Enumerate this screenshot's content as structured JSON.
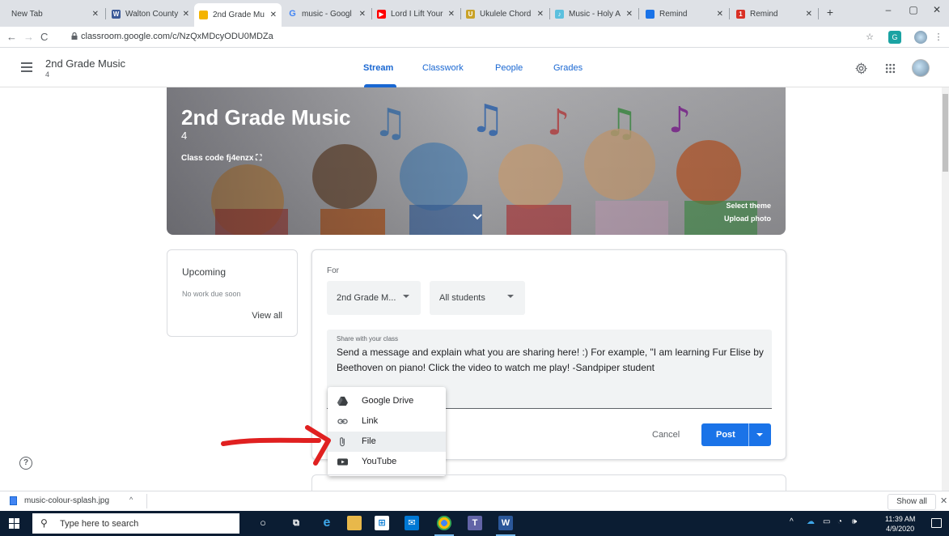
{
  "browser": {
    "tabs": [
      {
        "title": "New Tab",
        "favicon": "none"
      },
      {
        "title": "Walton County",
        "favicon": "walton-icon",
        "color": "#3b5998"
      },
      {
        "title": "2nd Grade Mu",
        "favicon": "classroom-icon",
        "color": "#f4b400",
        "active": true
      },
      {
        "title": "music - Googl",
        "favicon": "google-icon",
        "color": "#4285f4"
      },
      {
        "title": "Lord I Lift Your",
        "favicon": "youtube-icon",
        "color": "#ff0000"
      },
      {
        "title": "Ukulele Chord",
        "favicon": "ukulele-icon",
        "color": "#c9a227"
      },
      {
        "title": "Music - Holy A",
        "favicon": "music-icon",
        "color": "#5bc0de"
      },
      {
        "title": "Remind",
        "favicon": "remind-icon",
        "color": "#1a73e8"
      },
      {
        "title": "Remind",
        "favicon": "remind-red-icon",
        "color": "#d93025"
      }
    ],
    "url": "classroom.google.com/c/NzQxMDcyODU0MDZa"
  },
  "header": {
    "class_name": "2nd Grade Music",
    "section": "4",
    "tabs": [
      "Stream",
      "Classwork",
      "People",
      "Grades"
    ],
    "active_tab": "Stream"
  },
  "banner": {
    "title": "2nd Grade Music",
    "section": "4",
    "class_code_label": "Class code",
    "class_code": "fj4enzx",
    "select_theme": "Select theme",
    "upload_photo": "Upload photo"
  },
  "upcoming": {
    "title": "Upcoming",
    "empty_text": "No work due soon",
    "view_all": "View all"
  },
  "composer": {
    "for_label": "For",
    "class_select": "2nd Grade M...",
    "students_select": "All students",
    "message_label": "Share with your class",
    "message": "Send a message and explain what you are sharing here! :) For example, \"I am learning Fur Elise by Beethoven on piano! Click the video to watch me play! -Sandpiper student",
    "cancel": "Cancel",
    "post": "Post",
    "attach_menu": [
      {
        "label": "Google Drive",
        "icon": "google-drive-icon"
      },
      {
        "label": "Link",
        "icon": "link-icon"
      },
      {
        "label": "File",
        "icon": "paperclip-icon",
        "highlighted": true
      },
      {
        "label": "YouTube",
        "icon": "youtube-icon"
      }
    ]
  },
  "downloads": {
    "file_name": "music-colour-splash.jpg",
    "show_all": "Show all"
  },
  "taskbar": {
    "search_placeholder": "Type here to search",
    "time": "11:39 AM",
    "date": "4/9/2020"
  },
  "colors": {
    "accent": "#1967d2",
    "post_button": "#1a73e8",
    "annotation_arrow": "#e02020"
  }
}
